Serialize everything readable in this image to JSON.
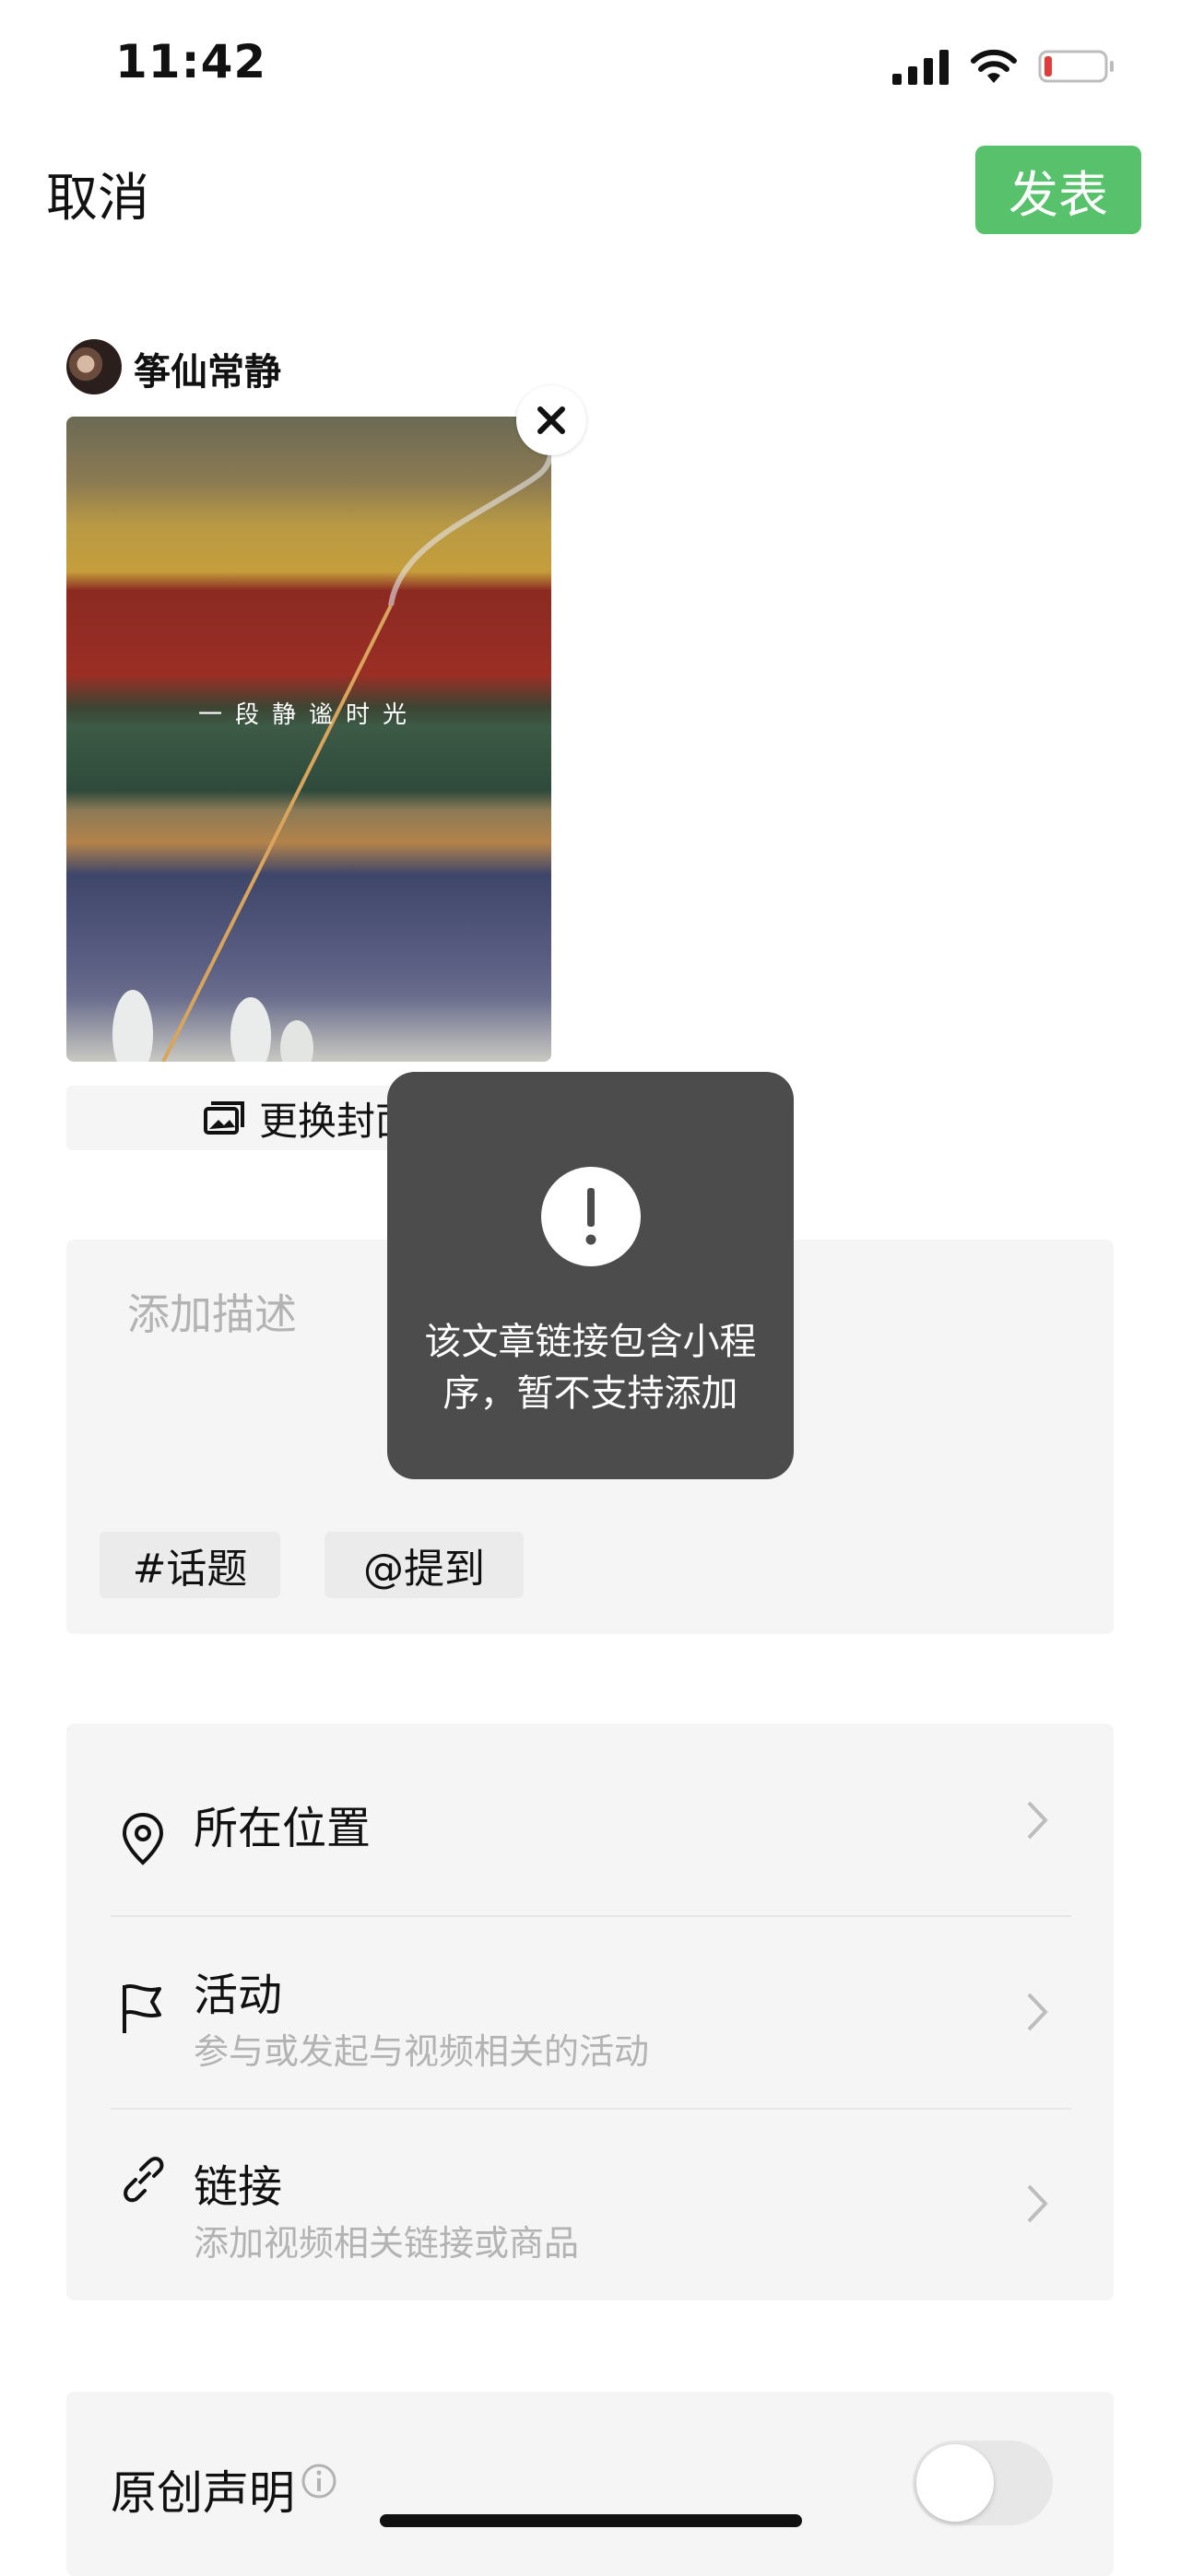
{
  "status_bar": {
    "time": "11:42"
  },
  "nav": {
    "cancel": "取消",
    "publish": "发表"
  },
  "author": {
    "name": "筝仙常静"
  },
  "cover": {
    "overlay_text": "一段静谧时光",
    "change_label": "更换封面"
  },
  "description": {
    "placeholder": "添加描述",
    "topic_chip": "#话题",
    "mention_chip": "@提到"
  },
  "options": [
    {
      "title": "所在位置",
      "subtitle": "",
      "icon": "location-pin-icon"
    },
    {
      "title": "活动",
      "subtitle": "参与或发起与视频相关的活动",
      "icon": "flag-icon"
    },
    {
      "title": "链接",
      "subtitle": "添加视频相关链接或商品",
      "icon": "link-icon"
    }
  ],
  "original": {
    "title": "原创声明",
    "toggle_on": false
  },
  "toast": {
    "message_line1": "该文章链接包含小程",
    "message_line2": "序，暂不支持添加"
  },
  "colors": {
    "accent_green": "#57c16b",
    "toast_bg": "#4c4c4c",
    "panel_bg": "#f5f5f5"
  }
}
